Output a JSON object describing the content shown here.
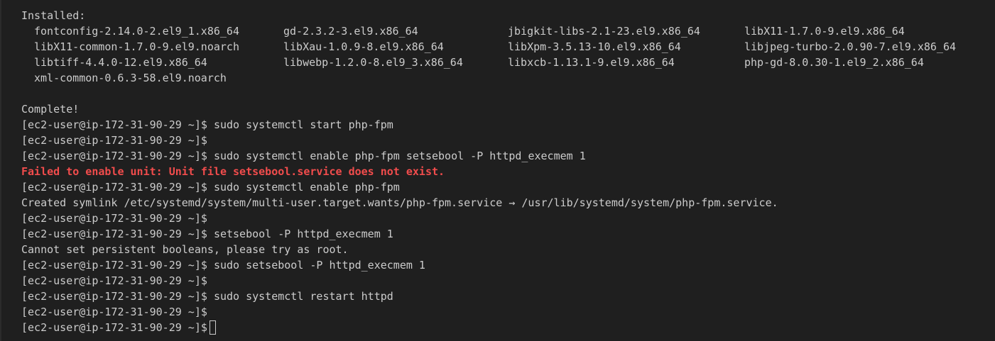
{
  "terminal": {
    "installed_header": "Installed:",
    "packages": [
      [
        "fontconfig-2.14.0-2.el9_1.x86_64",
        "gd-2.3.2-3.el9.x86_64",
        "jbigkit-libs-2.1-23.el9.x86_64",
        "libX11-1.7.0-9.el9.x86_64"
      ],
      [
        "libX11-common-1.7.0-9.el9.noarch",
        "libXau-1.0.9-8.el9.x86_64",
        "libXpm-3.5.13-10.el9.x86_64",
        "libjpeg-turbo-2.0.90-7.el9.x86_64"
      ],
      [
        "libtiff-4.4.0-12.el9.x86_64",
        "libwebp-1.2.0-8.el9_3.x86_64",
        "libxcb-1.13.1-9.el9.x86_64",
        "php-gd-8.0.30-1.el9_2.x86_64"
      ],
      [
        "xml-common-0.6.3-58.el9.noarch"
      ]
    ],
    "complete": "Complete!",
    "prompt": "[ec2-user@ip-172-31-90-29 ~]$",
    "lines": [
      {
        "type": "cmd",
        "text": "sudo systemctl start php-fpm"
      },
      {
        "type": "cmd",
        "text": ""
      },
      {
        "type": "cmd",
        "text": "sudo systemctl enable php-fpm setsebool -P httpd_execmem 1"
      },
      {
        "type": "error",
        "text": "Failed to enable unit: Unit file setsebool.service does not exist."
      },
      {
        "type": "cmd",
        "text": "sudo systemctl enable php-fpm"
      },
      {
        "type": "output",
        "text": "Created symlink /etc/systemd/system/multi-user.target.wants/php-fpm.service → /usr/lib/systemd/system/php-fpm.service."
      },
      {
        "type": "cmd",
        "text": ""
      },
      {
        "type": "cmd",
        "text": "setsebool -P httpd_execmem 1"
      },
      {
        "type": "output",
        "text": "Cannot set persistent booleans, please try as root."
      },
      {
        "type": "cmd",
        "text": "sudo setsebool -P httpd_execmem 1"
      },
      {
        "type": "cmd",
        "text": ""
      },
      {
        "type": "cmd",
        "text": "sudo systemctl restart httpd"
      },
      {
        "type": "cmd",
        "text": ""
      },
      {
        "type": "active",
        "text": ""
      }
    ],
    "colors": {
      "background": "#1f1f1f",
      "text": "#cccccc",
      "error": "#f14c4c"
    }
  }
}
